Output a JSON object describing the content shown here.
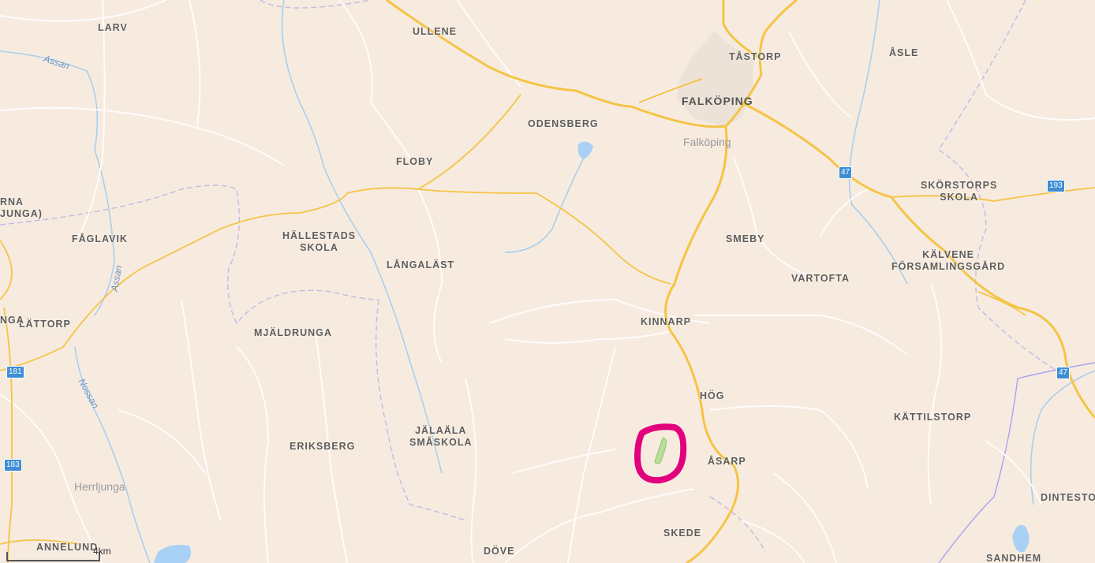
{
  "map": {
    "places": [
      {
        "id": "larv",
        "label": "LARV"
      },
      {
        "id": "ullene",
        "label": "ULLENE"
      },
      {
        "id": "tastorp",
        "label": "TÅSTORP"
      },
      {
        "id": "asle",
        "label": "ÅSLE"
      },
      {
        "id": "odensberg",
        "label": "ODENSBERG"
      },
      {
        "id": "floby",
        "label": "FLOBY"
      },
      {
        "id": "skorstorps",
        "label": "SKÖRSTORPS\nSKOLA"
      },
      {
        "id": "faglavik",
        "label": "FÅGLAVIK"
      },
      {
        "id": "hallestads",
        "label": "HÄLLESTADS\nSKOLA"
      },
      {
        "id": "smeby",
        "label": "SMEBY"
      },
      {
        "id": "langalast",
        "label": "LÅNGALÄST"
      },
      {
        "id": "vartofta",
        "label": "VARTOFTA"
      },
      {
        "id": "kalvene",
        "label": "KÄLVENE\nFÖRSAMLINGSGÅRD"
      },
      {
        "id": "lattorp",
        "label": "LÄTTORP"
      },
      {
        "id": "kinnarp",
        "label": "KINNARP"
      },
      {
        "id": "mjaldrunga",
        "label": "MJÄLDRUNGA"
      },
      {
        "id": "hog",
        "label": "HÖG"
      },
      {
        "id": "kattilstorp",
        "label": "KÄTTILSTORP"
      },
      {
        "id": "jalaala",
        "label": "JÄLAÄLA\nSMÅSKOLA"
      },
      {
        "id": "eriksberg",
        "label": "ERIKSBERG"
      },
      {
        "id": "asarp",
        "label": "ÅSARP"
      },
      {
        "id": "dintestorp",
        "label": "DINTESTO"
      },
      {
        "id": "skede",
        "label": "SKEDE"
      },
      {
        "id": "annelund",
        "label": "ANNELUND"
      },
      {
        "id": "dove",
        "label": "DÖVE"
      },
      {
        "id": "sandhem",
        "label": "SANDHEM"
      },
      {
        "id": "rna",
        "label": "RNA\nJUNGA)"
      },
      {
        "id": "nga",
        "label": "NGA"
      }
    ],
    "towns": [
      {
        "id": "falkoping-bold",
        "label": "FALKÖPING",
        "strong": true
      },
      {
        "id": "falkoping",
        "label": "Falköping",
        "strong": false
      },
      {
        "id": "herrljunga",
        "label": "Herrljunga",
        "strong": false
      }
    ],
    "rivers": [
      {
        "id": "assan-top",
        "label": "Assan"
      },
      {
        "id": "assan-mid",
        "label": "Assan"
      },
      {
        "id": "nossan",
        "label": "Nossan"
      }
    ],
    "shields": [
      {
        "id": "r47a",
        "label": "47"
      },
      {
        "id": "r193",
        "label": "193"
      },
      {
        "id": "r181",
        "label": "181"
      },
      {
        "id": "r47b",
        "label": "47"
      },
      {
        "id": "r183",
        "label": "183"
      }
    ],
    "scale": {
      "label": "4km"
    },
    "colors": {
      "background": "#f7ebdf",
      "major_road": "#f5c445",
      "minor_road": "#ffffff",
      "water": "#a8d1f5",
      "boundary": "#c9b6e6",
      "highlight": "#e3007d",
      "highlight_fill": "#b6dd9a"
    }
  }
}
